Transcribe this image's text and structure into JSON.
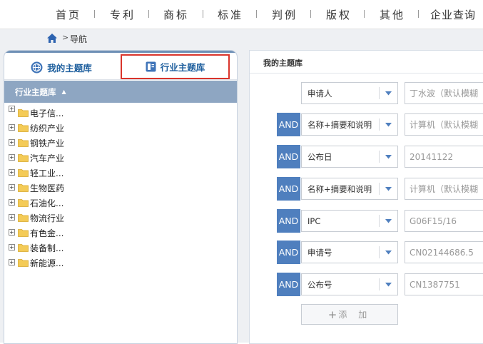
{
  "top_nav": {
    "items": [
      "首页",
      "专利",
      "商标",
      "标准",
      "判例",
      "版权",
      "其他",
      "企业查询"
    ]
  },
  "breadcrumb": {
    "separator": ">",
    "label": "导航"
  },
  "left_panel": {
    "tabs": {
      "mine": "我的主题库",
      "industry": "行业主题库"
    },
    "header": "行业主题库",
    "tree": [
      "电子信...",
      "纺织产业",
      "钢铁产业",
      "汽车产业",
      "轻工业...",
      "生物医药",
      "石油化...",
      "物流行业",
      "有色金...",
      "装备制...",
      "新能源..."
    ]
  },
  "right_panel": {
    "title": "我的主题库",
    "operator": "AND",
    "rows": [
      {
        "field": "申请人",
        "value": "丁水波（默认模糊"
      },
      {
        "field": "名称+摘要和说明",
        "value": "计算机（默认模糊"
      },
      {
        "field": "公布日",
        "value": "20141122"
      },
      {
        "field": "名称+摘要和说明",
        "value": "计算机（默认模糊"
      },
      {
        "field": "IPC",
        "value": "G06F15/16"
      },
      {
        "field": "申请号",
        "value": "CN02144686.5"
      },
      {
        "field": "公布号",
        "value": "CN1387751"
      }
    ],
    "add_label": "添 加"
  },
  "colors": {
    "accent_blue": "#4f7fbe",
    "header_blue": "#8ea6c2",
    "highlight_red": "#d9342b",
    "tab_text": "#1e5f9e"
  }
}
